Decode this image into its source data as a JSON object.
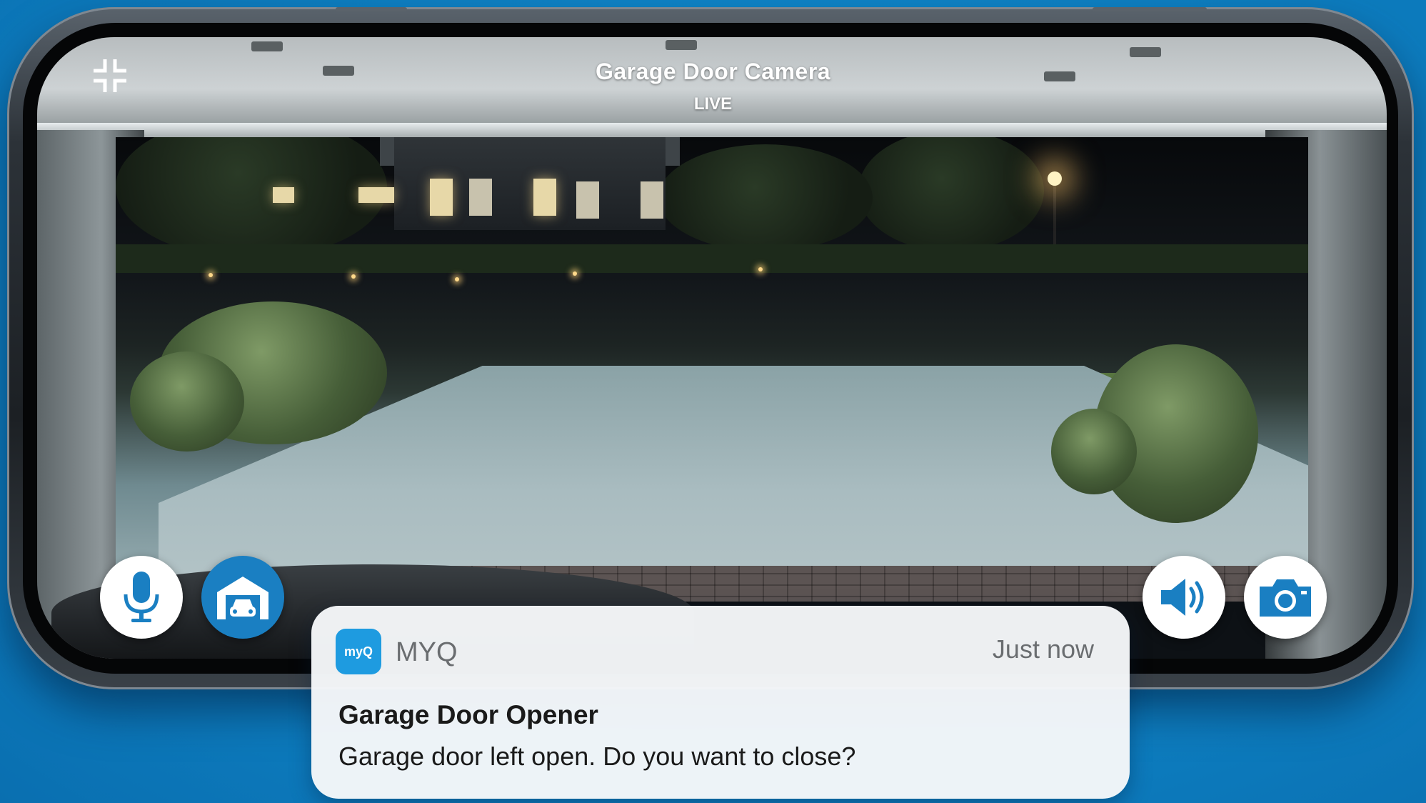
{
  "camera": {
    "title": "Garage Door Camera",
    "status": "LIVE"
  },
  "controls": {
    "minimize_icon": "minimize-icon",
    "microphone_icon": "microphone-icon",
    "garage_door_icon": "garage-door-icon",
    "speaker_icon": "speaker-icon",
    "camera_icon": "camera-icon"
  },
  "notification": {
    "app_icon_label": "myQ",
    "app_name": "MYQ",
    "time": "Just now",
    "title": "Garage Door Opener",
    "body": "Garage door left open. Do you want to close?"
  },
  "colors": {
    "background": "#0f86c9",
    "accent": "#1a7fc2",
    "app_icon": "#1e9be0"
  }
}
